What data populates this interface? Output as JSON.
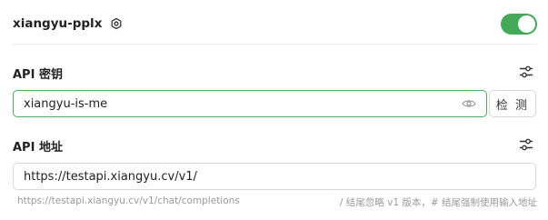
{
  "provider": {
    "name": "xiangyu-pplx",
    "enabled": true
  },
  "api_key": {
    "label": "API 密钥",
    "value": "xiangyu-is-me",
    "check_label": "检 测"
  },
  "api_url": {
    "label": "API 地址",
    "value": "https://testapi.xiangyu.cv/v1/",
    "preview": "https://testapi.xiangyu.cv/v1/chat/completions",
    "hint": "/ 结尾忽略 v1 版本，# 结尾强制使用输入地址"
  },
  "icons": {
    "settings": "settings-icon",
    "toggle": "toggle-switch",
    "adjust": "adjust-icon",
    "eye": "eye-icon"
  },
  "colors": {
    "accent": "#43a857",
    "input_focus_border": "#4caf63",
    "hint_text": "#9a9a9a"
  }
}
